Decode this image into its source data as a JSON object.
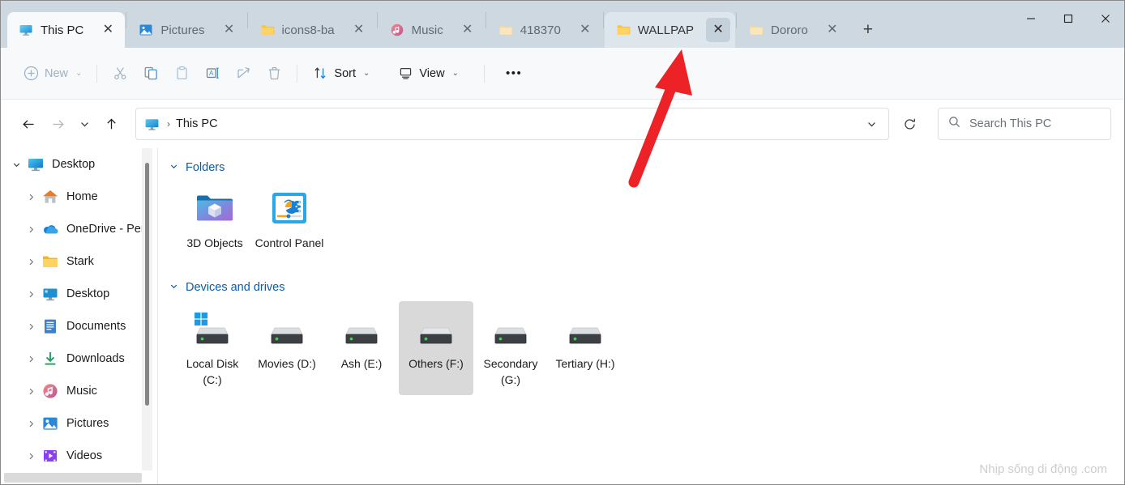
{
  "window": {
    "controls": {
      "minimize": "─",
      "maximize": "□",
      "close": "✕"
    }
  },
  "tabs": {
    "new_tab_label": "+",
    "items": [
      {
        "label": "This PC",
        "icon": "monitor-icon",
        "state": "active",
        "close": "✕"
      },
      {
        "label": "Pictures",
        "icon": "pictures-icon",
        "state": "inactive",
        "close": "✕"
      },
      {
        "label": "icons8-ba",
        "icon": "folder-icon",
        "state": "inactive",
        "close": "✕"
      },
      {
        "label": "Music",
        "icon": "music-icon",
        "state": "inactive",
        "close": "✕"
      },
      {
        "label": "418370",
        "icon": "folder-icon",
        "state": "inactive",
        "close": "✕"
      },
      {
        "label": "WALLPAP",
        "icon": "folder-icon",
        "state": "hover",
        "close": "✕"
      },
      {
        "label": "Dororo",
        "icon": "folder-icon",
        "state": "inactive",
        "close": "✕"
      }
    ]
  },
  "toolbar": {
    "new_label": "New",
    "cut_label": "Cut",
    "copy_label": "Copy",
    "paste_label": "Paste",
    "rename_label": "Rename",
    "share_label": "Share",
    "delete_label": "Delete",
    "sort_label": "Sort",
    "view_label": "View",
    "more_label": "•••",
    "chevron": "⌄"
  },
  "addressbar": {
    "back": "←",
    "forward": "→",
    "recent": "⌄",
    "up": "↑",
    "crumb_icon": "monitor-icon",
    "crumb_separator": "›",
    "crumb_text": "This PC",
    "dropdown": "⌄",
    "refresh": "refresh-icon"
  },
  "search": {
    "placeholder": "Search This PC",
    "icon": "search-icon"
  },
  "sidebar": {
    "items": [
      {
        "label": "Desktop",
        "icon": "desktop-icon",
        "expander": "⌄",
        "expanded": true,
        "indent": 0
      },
      {
        "label": "Home",
        "icon": "home-icon",
        "expander": "›",
        "expanded": false,
        "indent": 1
      },
      {
        "label": "OneDrive - Per",
        "icon": "onedrive-icon",
        "expander": "›",
        "expanded": false,
        "indent": 1
      },
      {
        "label": "Stark",
        "icon": "folder-icon",
        "expander": "›",
        "expanded": false,
        "indent": 1
      },
      {
        "label": "Desktop",
        "icon": "desktop-icon",
        "expander": "›",
        "expanded": false,
        "indent": 1
      },
      {
        "label": "Documents",
        "icon": "documents-icon",
        "expander": "›",
        "expanded": false,
        "indent": 1
      },
      {
        "label": "Downloads",
        "icon": "downloads-icon",
        "expander": "›",
        "expanded": false,
        "indent": 1
      },
      {
        "label": "Music",
        "icon": "music-icon",
        "expander": "›",
        "expanded": false,
        "indent": 1
      },
      {
        "label": "Pictures",
        "icon": "pictures-icon",
        "expander": "›",
        "expanded": false,
        "indent": 1
      },
      {
        "label": "Videos",
        "icon": "videos-icon",
        "expander": "›",
        "expanded": false,
        "indent": 1
      }
    ]
  },
  "content": {
    "groups": [
      {
        "title": "Folders",
        "chevron": "⌄",
        "items": [
          {
            "label": "3D Objects",
            "icon": "3d-objects-folder-icon",
            "selected": false
          },
          {
            "label": "Control Panel",
            "icon": "control-panel-icon",
            "selected": false
          }
        ]
      },
      {
        "title": "Devices and drives",
        "chevron": "⌄",
        "items": [
          {
            "label": "Local Disk (C:)",
            "icon": "windows-drive-icon",
            "selected": false
          },
          {
            "label": "Movies (D:)",
            "icon": "drive-icon",
            "selected": false
          },
          {
            "label": "Ash (E:)",
            "icon": "drive-icon",
            "selected": false
          },
          {
            "label": "Others (F:)",
            "icon": "drive-icon",
            "selected": true
          },
          {
            "label": "Secondary (G:)",
            "icon": "drive-icon",
            "selected": false
          },
          {
            "label": "Tertiary (H:)",
            "icon": "drive-icon",
            "selected": false
          }
        ]
      }
    ],
    "watermark": "Nhịp sống di động .com"
  },
  "annotation": {
    "arrow_color": "#ec2227",
    "points_to": "WALLPAP"
  },
  "colors": {
    "titlebar": "#cdd8e0",
    "commandbar": "#f7f9fa",
    "accent": "#0c5ca8",
    "selection": "#d9d9d9",
    "arrow": "#ec2227"
  }
}
